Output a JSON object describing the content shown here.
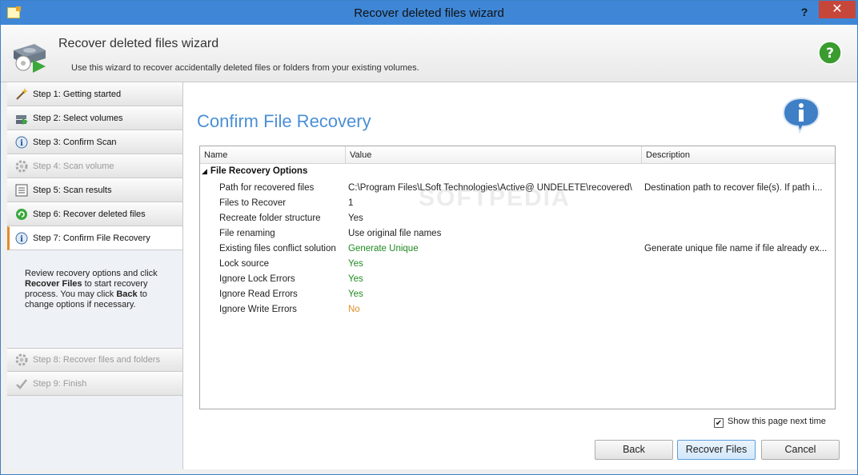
{
  "window": {
    "title": "Recover deleted files wizard",
    "help_glyph": "?",
    "close_glyph": "✕"
  },
  "banner": {
    "title": "Recover deleted files wizard",
    "subtitle": "Use this wizard to recover accidentally deleted files or folders from your existing volumes."
  },
  "steps": [
    {
      "label": "Step 1: Getting started",
      "icon": "wand-icon",
      "state": "done"
    },
    {
      "label": "Step 2: Select volumes",
      "icon": "drives-icon",
      "state": "done"
    },
    {
      "label": "Step 3: Confirm Scan",
      "icon": "info-icon",
      "state": "done"
    },
    {
      "label": "Step 4: Scan volume",
      "icon": "gear-icon",
      "state": "disabled"
    },
    {
      "label": "Step 5: Scan results",
      "icon": "list-icon",
      "state": "done"
    },
    {
      "label": "Step 6: Recover deleted files",
      "icon": "recycle-icon",
      "state": "done"
    },
    {
      "label": "Step 7: Confirm File Recovery",
      "icon": "info-icon",
      "state": "active"
    },
    {
      "label": "Step 8: Recover files and folders",
      "icon": "gear-icon",
      "state": "disabled"
    },
    {
      "label": "Step 9: Finish",
      "icon": "checkmark-icon",
      "state": "disabled"
    }
  ],
  "step_description": {
    "part1": "Review recovery options and click ",
    "bold1": "Recover Files",
    "part2": " to start recovery process. You may click ",
    "bold2": "Back",
    "part3": " to change options if necessary."
  },
  "main": {
    "title": "Confirm File Recovery",
    "grid": {
      "columns": [
        "Name",
        "Value",
        "Description"
      ],
      "group": "File Recovery Options",
      "rows": [
        {
          "name": "Path for recovered files",
          "value": "C:\\Program Files\\LSoft Technologies\\Active@ UNDELETE\\recovered\\",
          "desc": "Destination path to recover file(s). If path i...",
          "tone": "normal"
        },
        {
          "name": "Files to Recover",
          "value": "1",
          "desc": "",
          "tone": "normal"
        },
        {
          "name": "Recreate folder structure",
          "value": "Yes",
          "desc": "",
          "tone": "normal"
        },
        {
          "name": "File renaming",
          "value": "Use original file names",
          "desc": "",
          "tone": "normal"
        },
        {
          "name": "Existing files conflict solution",
          "value": "Generate Unique",
          "desc": "Generate unique file name if file already ex...",
          "tone": "green"
        },
        {
          "name": "Lock source",
          "value": "Yes",
          "desc": "",
          "tone": "green"
        },
        {
          "name": "Ignore Lock Errors",
          "value": "Yes",
          "desc": "",
          "tone": "green"
        },
        {
          "name": "Ignore Read Errors",
          "value": "Yes",
          "desc": "",
          "tone": "green"
        },
        {
          "name": "Ignore Write Errors",
          "value": "No",
          "desc": "",
          "tone": "orange"
        }
      ]
    },
    "watermark": "SOFTPEDIA",
    "show_page_label": "Show this page next time",
    "show_page_checked": true,
    "buttons": {
      "back": "Back",
      "recover": "Recover Files",
      "cancel": "Cancel"
    }
  },
  "colors": {
    "accent": "#4a8fd6",
    "active_step_marker": "#e38b2a",
    "yes_value": "#1f8a1f",
    "no_value": "#e0902a"
  }
}
